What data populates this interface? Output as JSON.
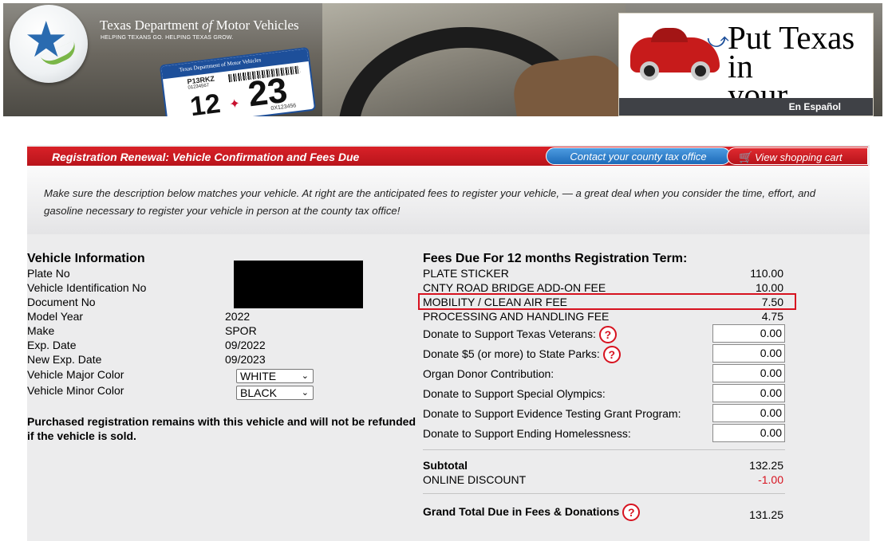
{
  "header": {
    "agency_name_part1": "Texas Department ",
    "agency_name_of": "of",
    "agency_name_part2": " Motor Vehicles",
    "tagline": "HELPING TEXANS GO. HELPING TEXAS GROW.",
    "sticker": {
      "agency": "Texas Department of Motor Vehicles",
      "plate": "P13RKZ",
      "plate_sub": "01234567",
      "month": "12",
      "year": "23",
      "code": "0X123456"
    },
    "promo_line1": "Put Texas in",
    "promo_line2": "your corner.",
    "espanol_link": "En Español"
  },
  "titlebar": {
    "title": "Registration Renewal: Vehicle Confirmation and Fees Due",
    "contact_link": "Contact your county tax office",
    "cart_link": "View shopping cart"
  },
  "intro_text": "Make sure the description below matches your vehicle. At right are the anticipated fees to register your vehicle, — a great deal when you consider the time, effort, and gasoline necessary to register your vehicle in person at the county tax office!",
  "vehicle": {
    "heading": "Vehicle Information",
    "rows": [
      {
        "label": "Plate No",
        "value": ""
      },
      {
        "label": "Vehicle Identification No",
        "value": ""
      },
      {
        "label": "Document No",
        "value": ""
      },
      {
        "label": "Model Year",
        "value": "2022"
      },
      {
        "label": "Make",
        "value": "SPOR"
      },
      {
        "label": "Exp. Date",
        "value": "09/2022"
      },
      {
        "label": "New Exp. Date",
        "value": "09/2023"
      }
    ],
    "major_color_label": "Vehicle Major Color",
    "major_color_value": "WHITE",
    "minor_color_label": "Vehicle Minor Color",
    "minor_color_value": "BLACK",
    "notice": "Purchased registration remains with this vehicle and will not be refunded if the vehicle is sold."
  },
  "fees": {
    "heading": "Fees Due For 12 months Registration Term:",
    "items": [
      {
        "label": "PLATE STICKER",
        "amount": "110.00"
      },
      {
        "label": "CNTY ROAD BRIDGE ADD-ON FEE",
        "amount": "10.00"
      },
      {
        "label": "MOBILITY / CLEAN AIR FEE",
        "amount": "7.50"
      },
      {
        "label": "PROCESSING AND HANDLING FEE",
        "amount": "4.75"
      }
    ],
    "donations": [
      {
        "label": "Donate to Support Texas Veterans:",
        "value": "0.00",
        "help": true
      },
      {
        "label": "Donate $5 (or more) to State Parks:",
        "value": "0.00",
        "help": true
      },
      {
        "label": "Organ Donor Contribution:",
        "value": "0.00",
        "help": false
      },
      {
        "label": "Donate to Support Special Olympics:",
        "value": "0.00",
        "help": false
      },
      {
        "label": "Donate to Support Evidence Testing Grant Program:",
        "value": "0.00",
        "help": false
      },
      {
        "label": "Donate to Support Ending Homelessness:",
        "value": "0.00",
        "help": false
      }
    ],
    "help_glyph": "?",
    "subtotal_label": "Subtotal",
    "subtotal_amount": "132.25",
    "discount_label": "ONLINE DISCOUNT",
    "discount_amount": "-1.00",
    "grand_total_label": "Grand Total Due in Fees & Donations",
    "grand_total_amount": "131.25"
  },
  "colors": {
    "accent_red": "#d7121f",
    "link_blue": "#1c6ab8"
  }
}
